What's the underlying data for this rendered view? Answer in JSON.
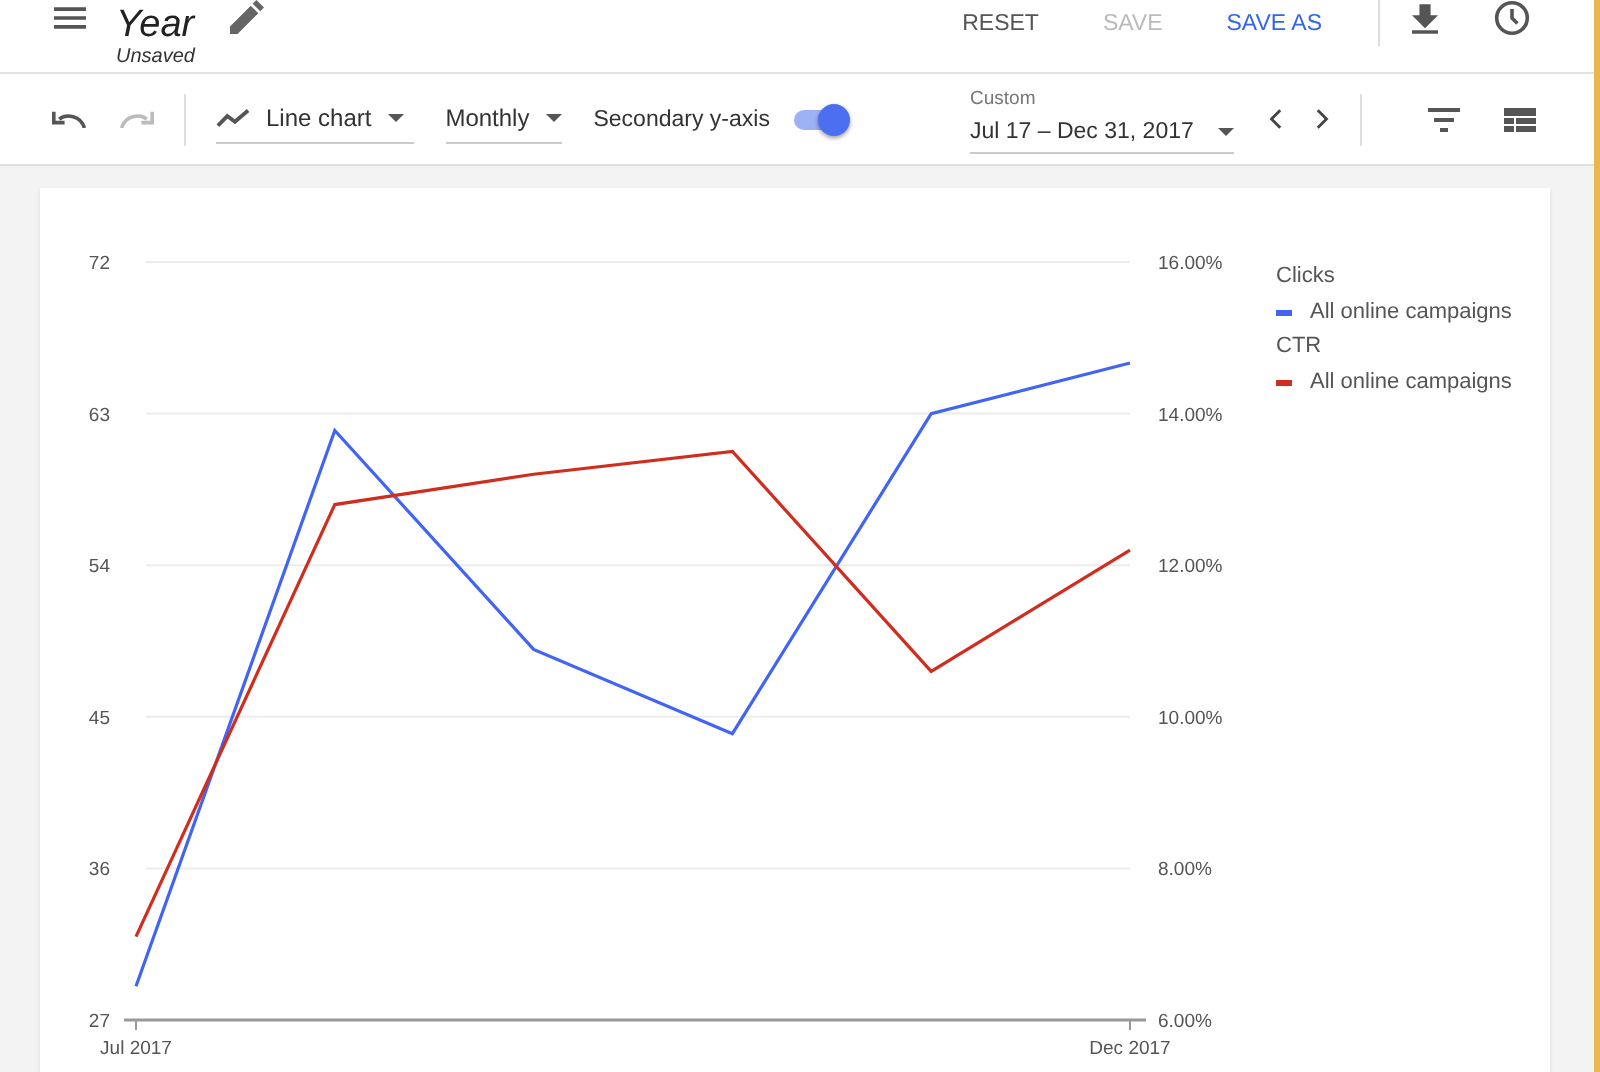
{
  "header": {
    "title": "Year",
    "subtitle": "Unsaved",
    "actions": [
      {
        "label": "RESET",
        "kind": "text",
        "disabled": false
      },
      {
        "label": "SAVE",
        "kind": "text",
        "disabled": true
      },
      {
        "label": "SAVE AS",
        "kind": "primary",
        "disabled": false
      }
    ]
  },
  "toolbar": {
    "chart_type": "Line chart",
    "interval": "Monthly",
    "secondary_axis": {
      "label": "Secondary y-axis",
      "on": true
    },
    "date_range": {
      "label": "Custom",
      "value": "Jul 17 – Dec 31, 2017"
    }
  },
  "chart": {
    "legend": [
      {
        "label": "All online campaigns"
      },
      {
        "label": "All online campaigns"
      }
    ],
    "chart_data": {
      "type": "line",
      "grid": true,
      "categories": [
        "Jul 2017",
        null,
        null,
        null,
        null,
        "Dec 2017"
      ],
      "ylim": [
        27,
        72
      ],
      "yticks": [
        27,
        36,
        45,
        54,
        63,
        72
      ],
      "y2lim": [
        6,
        16
      ],
      "y2ticks": [
        {
          "value": 6,
          "label": "6.00%"
        },
        {
          "value": 8,
          "label": "8.00%"
        },
        {
          "value": 10,
          "label": "10.00%"
        },
        {
          "value": 12,
          "label": "12.00%"
        },
        {
          "value": 14,
          "label": "14.00%"
        },
        {
          "value": 16,
          "label": "16.00%"
        }
      ],
      "series": [
        {
          "name": "Clicks",
          "color": "#4264f5",
          "values": [
            29,
            62,
            49,
            44,
            63,
            66
          ]
        },
        {
          "name": "CTR",
          "color": "#d12d1f",
          "axis": "y2",
          "values": [
            7.1,
            12.8,
            13.2,
            13.5,
            10.6,
            12.2
          ]
        }
      ]
    }
  }
}
